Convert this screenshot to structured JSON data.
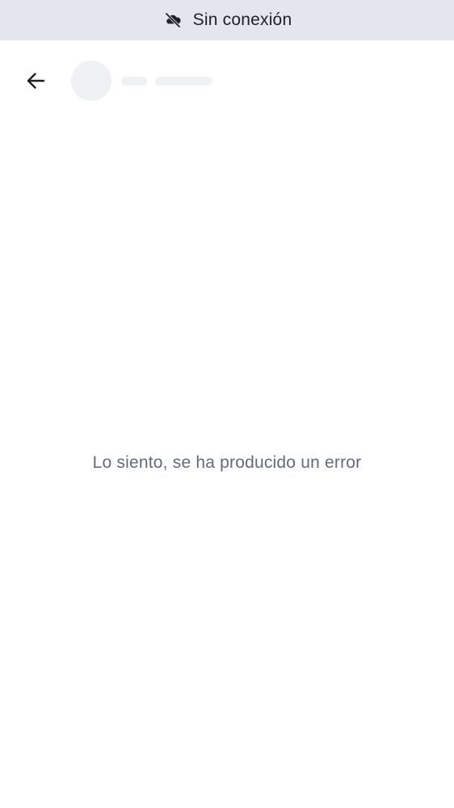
{
  "offline_banner": {
    "icon": "cloud-off-icon",
    "text": "Sin conexión",
    "background": "#e3e6ec"
  },
  "header": {
    "back_icon": "arrow-left-icon",
    "avatar_state": "loading-placeholder",
    "name_state": "loading-placeholder"
  },
  "main": {
    "error_text": "Lo siento, se ha producido un error",
    "error_color": "#636b78"
  }
}
